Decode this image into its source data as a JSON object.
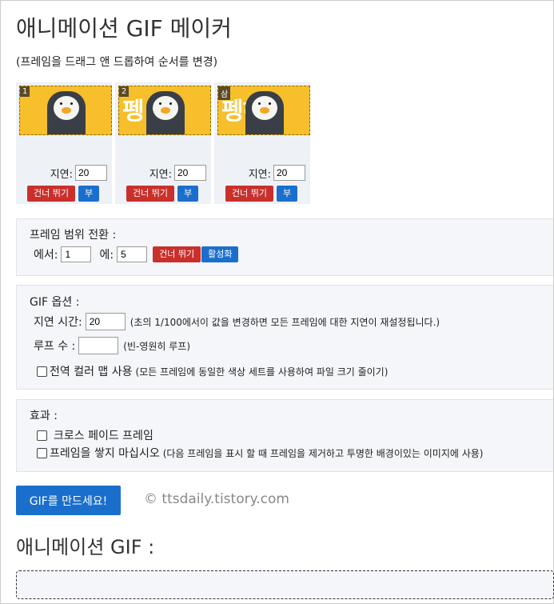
{
  "title": "애니메이션 GIF 메이커",
  "subtitle": "(프레임을 드래그 앤 드롭하여 순서를 변경)",
  "frames": [
    {
      "badge": "1",
      "delay_label": "지연:",
      "delay_value": "20",
      "skip_label": "건너 뛰기",
      "copy_label": "부",
      "text": ""
    },
    {
      "badge": "2",
      "delay_label": "지연:",
      "delay_value": "20",
      "skip_label": "건너 뛰기",
      "copy_label": "부",
      "text": "펭"
    },
    {
      "badge": "삼",
      "delay_label": "지연:",
      "delay_value": "20",
      "skip_label": "건너 뛰기",
      "copy_label": "부",
      "text": "펭하"
    }
  ],
  "range": {
    "heading": "프레임 범위 전환 :",
    "from_label": "에서:",
    "from_value": "1",
    "to_label": "에:",
    "to_value": "5",
    "skip_label": "건너 뛰기",
    "enable_label": "활성화"
  },
  "gif_options": {
    "heading": "GIF 옵션 :",
    "delay_label": "지연 시간:",
    "delay_value": "20",
    "delay_note": "(초의 1/100에서이 값을 변경하면 모든 프레임에 대한 지연이 재설정됩니다.)",
    "loop_label": "루프 수 :",
    "loop_value": "",
    "loop_note": "(빈-영원히 루프)",
    "global_palette_label": "전역 컬러 맵 사용",
    "global_palette_note": "(모든 프레임에 동일한 색상 세트를 사용하여 파일 크기 줄이기)"
  },
  "effects": {
    "heading": "효과 :",
    "crossfade_label": "크로스 페이드 프레임",
    "no_stack_label": "프레임을 쌓지 마십시오",
    "no_stack_note": "(다음 프레임을 표시 할 때 프레임을 제거하고 투명한 배경이있는 이미지에 사용)"
  },
  "make_button": "GIF를 만드세요!",
  "watermark": "© ttsdaily.tistory.com",
  "result_title": "애니메이션 GIF :",
  "colors": {
    "primary": "#1a6fcc",
    "danger": "#c9302c",
    "thumb_bg": "#f6bf2b",
    "panel_bg": "#f4f6f9"
  }
}
